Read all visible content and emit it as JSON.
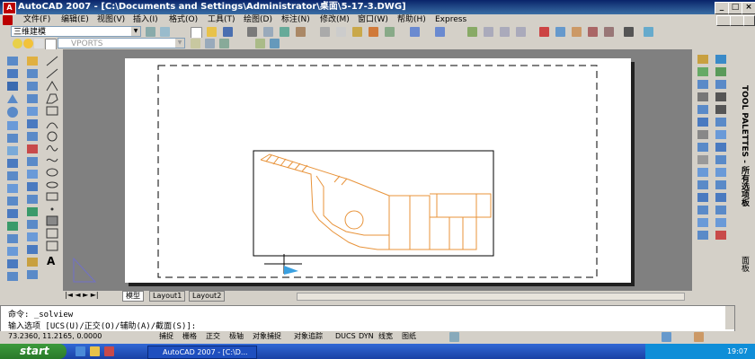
{
  "window": {
    "title": "AutoCAD 2007 - [C:\\Documents and Settings\\Administrator\\桌面\\5-17-3.DWG]",
    "app_icon": "autocad-icon",
    "controls": [
      "_",
      "□",
      "×"
    ]
  },
  "menu": [
    "文件(F)",
    "编辑(E)",
    "视图(V)",
    "插入(I)",
    "格式(O)",
    "工具(T)",
    "绘图(D)",
    "标注(N)",
    "修改(M)",
    "窗口(W)",
    "帮助(H)",
    "Express"
  ],
  "toolbar": {
    "workspace": "三维建模",
    "layer": "VPORTS"
  },
  "layout_tabs": [
    "模型",
    "Layout1",
    "Layout2"
  ],
  "command": {
    "line1": "命令:  _solview",
    "line2": "输入选项 [UCS(U)/正交(O)/辅助(A)/截面(S)]:"
  },
  "status": {
    "coords": "73.2360,  11.2165, 0.0000",
    "buttons": [
      "捕捉",
      "栅格",
      "正交",
      "极轴",
      "对象捕捉",
      "对象追踪",
      "DUCS",
      "DYN",
      "线宽",
      "图纸"
    ]
  },
  "palette": {
    "title": "TOOL PALETTES - 所有选项板",
    "tab": "面板"
  },
  "taskbar": {
    "start": "start",
    "item": "AutoCAD 2007 - [C:\\D...",
    "clock": "19:07"
  },
  "colors": {
    "drawing": "#e8933a",
    "title_bar": "#0a246a",
    "start_button": "#3c9a3c"
  }
}
